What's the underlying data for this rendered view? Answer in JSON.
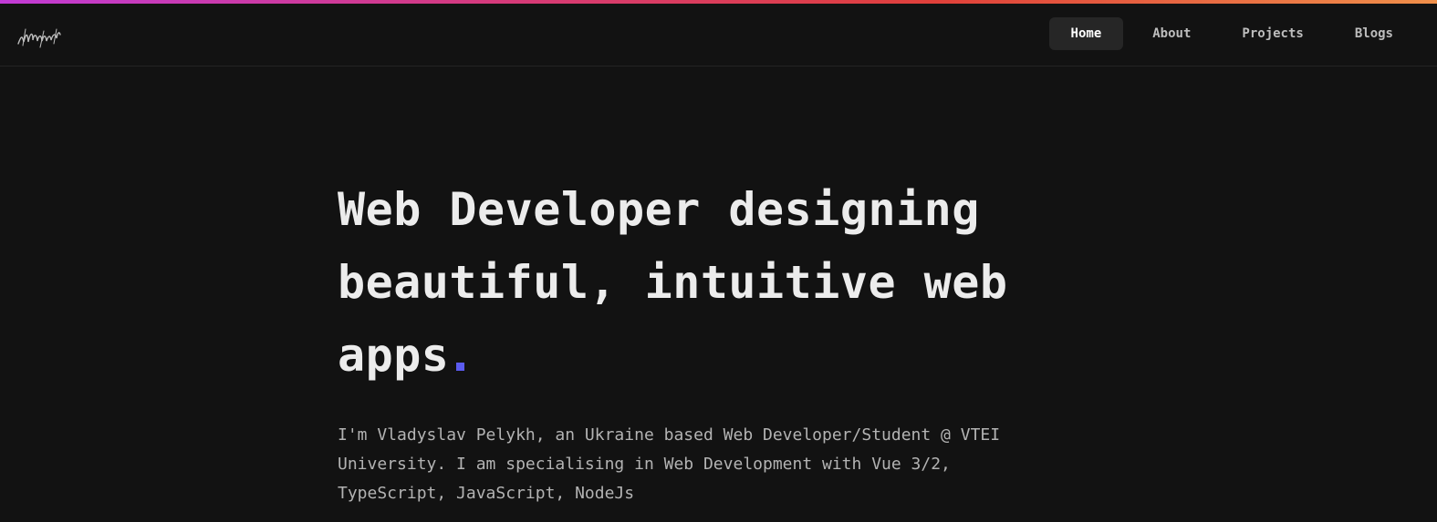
{
  "theme": {
    "background": "#121212",
    "accent_dot": "#5b5bf0",
    "gradient": [
      "#c13bd6",
      "#d63a7a",
      "#e0403a",
      "#f0904a"
    ]
  },
  "logo": {
    "icon": "signature-logo-icon"
  },
  "nav": {
    "items": [
      {
        "label": "Home",
        "active": true
      },
      {
        "label": "About",
        "active": false
      },
      {
        "label": "Projects",
        "active": false
      },
      {
        "label": "Blogs",
        "active": false
      }
    ]
  },
  "hero": {
    "line1": "Web Developer designing",
    "line2": "beautiful, intuitive web",
    "line3": "apps",
    "intro": "I'm Vladyslav Pelykh, an Ukraine based Web Developer/Student @ VTEI University. I am specialising in Web Development with Vue 3/2, TypeScript, JavaScript, NodeJs"
  }
}
